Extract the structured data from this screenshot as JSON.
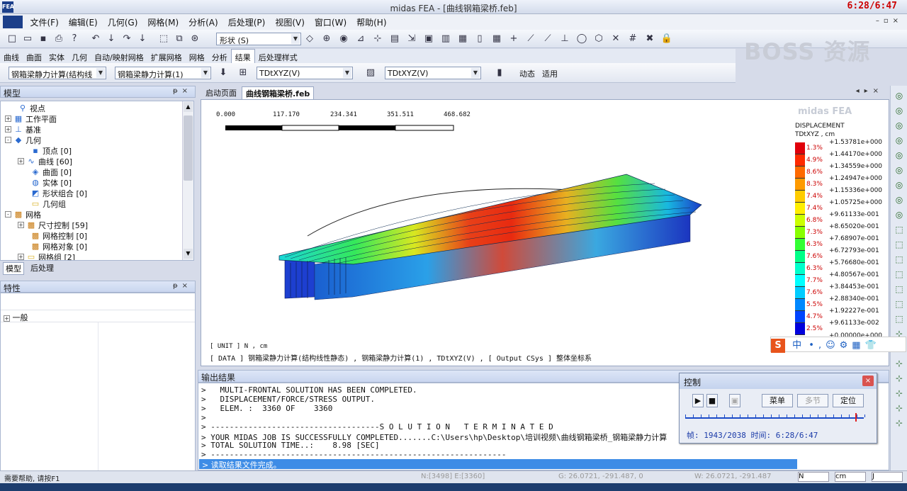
{
  "window": {
    "title": "midas FEA - [曲线钢箱梁桥.feb]",
    "clock": "6:28/6:47",
    "app_icon": "FEA"
  },
  "menu": [
    "文件(F)",
    "编辑(E)",
    "几何(G)",
    "网格(M)",
    "分析(A)",
    "后处理(P)",
    "视图(V)",
    "窗口(W)",
    "帮助(H)"
  ],
  "toolbar1": {
    "shape_combo": "形状 (S)"
  },
  "ribbon_tabs": [
    "曲线",
    "曲面",
    "实体",
    "几何",
    "自动/映射网格",
    "扩展网格",
    "网格",
    "分析",
    "结果",
    "后处理样式"
  ],
  "ribbon_active": "结果",
  "toolbar2": {
    "combo1": "钢箱梁静力计算(结构线",
    "combo2": "钢箱梁静力计算(1)",
    "combo3": "TDtXYZ(V)",
    "combo4": "TDtXYZ(V)",
    "anim_label": "动态",
    "apply_label": "适用"
  },
  "watermark": "BOSS 资源",
  "model_panel": {
    "title": "模型",
    "tree": [
      {
        "label": "视点",
        "icon": "viewpoint-icon",
        "level": 1,
        "exp": ""
      },
      {
        "label": "工作平面",
        "icon": "grid-icon",
        "level": 0,
        "exp": "+"
      },
      {
        "label": "基准",
        "icon": "axis-icon",
        "level": 0,
        "exp": "+"
      },
      {
        "label": "几何",
        "icon": "geometry-icon",
        "level": 0,
        "exp": "-"
      },
      {
        "label": "顶点 [0]",
        "icon": "vertex-icon",
        "level": 2,
        "exp": ""
      },
      {
        "label": "曲线 [60]",
        "icon": "curve-icon",
        "level": 1,
        "exp": "+"
      },
      {
        "label": "曲面 [0]",
        "icon": "surface-icon",
        "level": 2,
        "exp": ""
      },
      {
        "label": "实体 [0]",
        "icon": "solid-icon",
        "level": 2,
        "exp": ""
      },
      {
        "label": "形状组合 [0]",
        "icon": "shape-combo-icon",
        "level": 2,
        "exp": ""
      },
      {
        "label": "几何组",
        "icon": "folder-icon",
        "level": 2,
        "exp": ""
      },
      {
        "label": "网格",
        "icon": "mesh-icon",
        "level": 0,
        "exp": "-"
      },
      {
        "label": "尺寸控制 [59]",
        "icon": "mesh-icon",
        "level": 1,
        "exp": "+"
      },
      {
        "label": "网格控制 [0]",
        "icon": "mesh-icon",
        "level": 2,
        "exp": ""
      },
      {
        "label": "网格对象 [0]",
        "icon": "mesh-icon",
        "level": 2,
        "exp": ""
      },
      {
        "label": "网格组 [2]",
        "icon": "folder-icon",
        "level": 1,
        "exp": "+"
      }
    ],
    "tabs": [
      "模型",
      "后处理"
    ]
  },
  "props_panel": {
    "title": "特性",
    "group": "一般"
  },
  "view_tabs": [
    "启动页面",
    "曲线钢箱梁桥.feb"
  ],
  "view_active": "曲线钢箱梁桥.feb",
  "scale": [
    "0.000",
    "117.170",
    "234.341",
    "351.511",
    "468.682"
  ],
  "legend": {
    "brand": "midas FEA",
    "title": "DISPLACEMENT",
    "subtitle": "TDtXYZ , cm",
    "values": [
      "+1.53781e+000",
      "+1.44170e+000",
      "+1.34559e+000",
      "+1.24947e+000",
      "+1.15336e+000",
      "+1.05725e+000",
      "+9.61133e-001",
      "+8.65020e-001",
      "+7.68907e-001",
      "+6.72793e-001",
      "+5.76680e-001",
      "+4.80567e-001",
      "+3.84453e-001",
      "+2.88340e-001",
      "+1.92227e-001",
      "+9.61133e-002",
      "+0.00000e+000"
    ],
    "percents": [
      "1.3%",
      "4.9%",
      "8.6%",
      "8.3%",
      "7.4%",
      "7.4%",
      "6.8%",
      "7.3%",
      "6.3%",
      "7.6%",
      "6.3%",
      "7.7%",
      "7.6%",
      "5.5%",
      "4.7%",
      "2.5%"
    ],
    "colors": [
      "#e0000a",
      "#ff2a00",
      "#ff6a00",
      "#ff9a00",
      "#ffcc00",
      "#ffee00",
      "#ccff00",
      "#88ff00",
      "#33ff33",
      "#00ff88",
      "#00ffcc",
      "#00ffff",
      "#00ccff",
      "#0088ff",
      "#0044ff",
      "#0000dd"
    ]
  },
  "unit_line": "[ UNIT ]  N  ,  cm",
  "data_line": "[ DATA ]  钢箱梁静力计算(结构线性静态) ,  钢箱梁静力计算(1) ,  TDtXYZ(V) ,  [ Output CSys ]  整体坐标系",
  "output": {
    "title": "输出结果",
    "lines": [
      ">   MULTI-FRONTAL SOLUTION HAS BEEN COMPLETED.",
      ">   DISPLACEMENT/FORCE/STRESS OUTPUT.",
      ">   ELEM. :  3360 OF    3360",
      ">",
      "> ------------------------------------S O L U T I O N   T E R M I N A T E D",
      "> YOUR MIDAS JOB IS SUCCESSFULLY COMPLETED.......C:\\Users\\hp\\Desktop\\培训视频\\曲线钢箱梁桥_钢箱梁静力计算",
      "> TOTAL SOLUTION TIME..:    8.98 [SEC]",
      "> ---------------------------------------------------------------"
    ],
    "status": "> 读取结果文件完成。"
  },
  "control": {
    "title": "控制",
    "menu": "菜单",
    "step": "多节",
    "locate": "定位",
    "frame_text": "帧: 1943/2038 时间: 6:28/6:47",
    "progress": 0.953
  },
  "statusbar": {
    "help": "需要帮助, 请按F1",
    "nodes": "N:[3498] E:[3360]",
    "g_coord": "G: 26.0721, -291.487, 0",
    "w_coord": "W: 26.0721, -291.487",
    "force_unit": "N",
    "len_unit": "cm",
    "energy_unit": "J"
  },
  "ime": "中"
}
